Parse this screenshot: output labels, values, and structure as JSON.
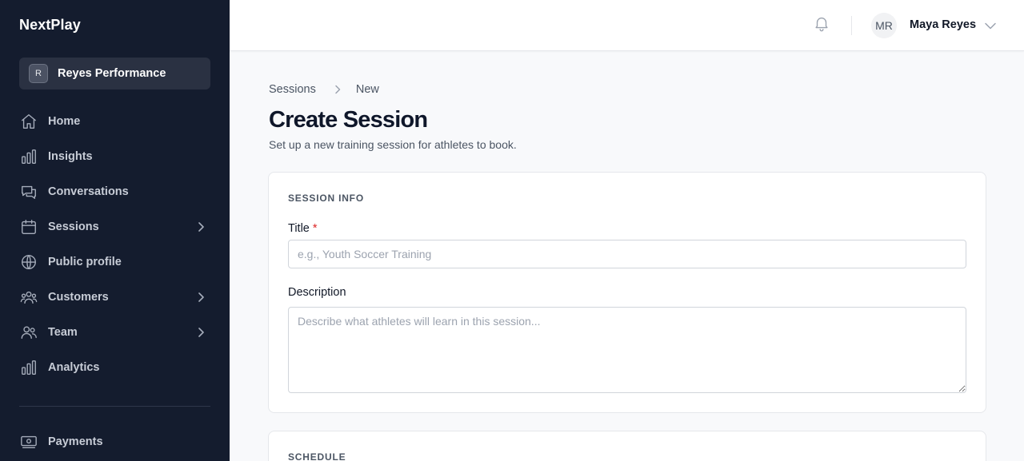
{
  "app": {
    "brand": "NextPlay"
  },
  "sidebar": {
    "org": {
      "initial": "R",
      "name": "Reyes Performance"
    },
    "items": [
      {
        "label": "Home",
        "icon": "home-icon",
        "has_children": false
      },
      {
        "label": "Insights",
        "icon": "bar-chart-icon",
        "has_children": false
      },
      {
        "label": "Conversations",
        "icon": "chat-bubbles-icon",
        "has_children": false
      },
      {
        "label": "Sessions",
        "icon": "calendar-icon",
        "has_children": true
      },
      {
        "label": "Public profile",
        "icon": "globe-icon",
        "has_children": false
      },
      {
        "label": "Customers",
        "icon": "users-group-icon",
        "has_children": true
      },
      {
        "label": "Team",
        "icon": "users-icon",
        "has_children": true
      },
      {
        "label": "Analytics",
        "icon": "bar-chart-icon",
        "has_children": false
      }
    ],
    "bottom_items": [
      {
        "label": "Payments",
        "icon": "banknote-icon"
      }
    ]
  },
  "topbar": {
    "user": {
      "initials": "MR",
      "name": "Maya Reyes"
    }
  },
  "breadcrumb": {
    "parent": "Sessions",
    "current": "New"
  },
  "page": {
    "title": "Create Session",
    "subtitle": "Set up a new training session for athletes to book."
  },
  "form": {
    "session_info": {
      "section_title": "SESSION INFO",
      "title_label": "Title",
      "title_required_mark": "*",
      "title_value": "",
      "title_placeholder": "e.g., Youth Soccer Training",
      "description_label": "Description",
      "description_value": "",
      "description_placeholder": "Describe what athletes will learn in this session..."
    },
    "schedule": {
      "section_title": "SCHEDULE"
    }
  }
}
